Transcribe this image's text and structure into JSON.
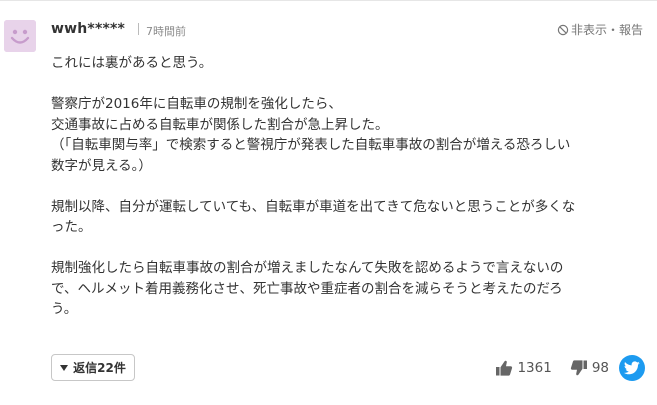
{
  "comment": {
    "user": "wwh*****",
    "time": "7時間前",
    "report_label": "非表示・報告",
    "paragraphs": [
      [
        "これには裏があると思う。"
      ],
      [
        "警察庁が2016年に自転車の規制を強化したら、",
        "交通事故に占める自転車が関係した割合が急上昇した。",
        "（「自転車関与率」で検索すると警視庁が発表した自転車事故の割合が増える恐ろしい",
        "数字が見える。）"
      ],
      [
        "規制以降、自分が運転していても、自転車が車道を出てきて危ないと思うことが多くな",
        "った。"
      ],
      [
        "規制強化したら自転車事故の割合が増えましたなんて失敗を認めるようで言えないの",
        "で、ヘルメット着用義務化させ、死亡事故や重症者の割合を減らそうと考えたのだろ",
        "う。"
      ]
    ]
  },
  "footer": {
    "reply_label": "返信22件",
    "good_count": "1361",
    "bad_count": "98"
  },
  "icons": {
    "avatar": "smiley-face-avatar",
    "report": "prohibited-icon",
    "good": "thumbs-up-icon",
    "bad": "thumbs-down-icon",
    "share": "twitter-bird-icon"
  },
  "colors": {
    "avatar_bg": "#e8d3ea",
    "twitter": "#1d9bf0"
  }
}
